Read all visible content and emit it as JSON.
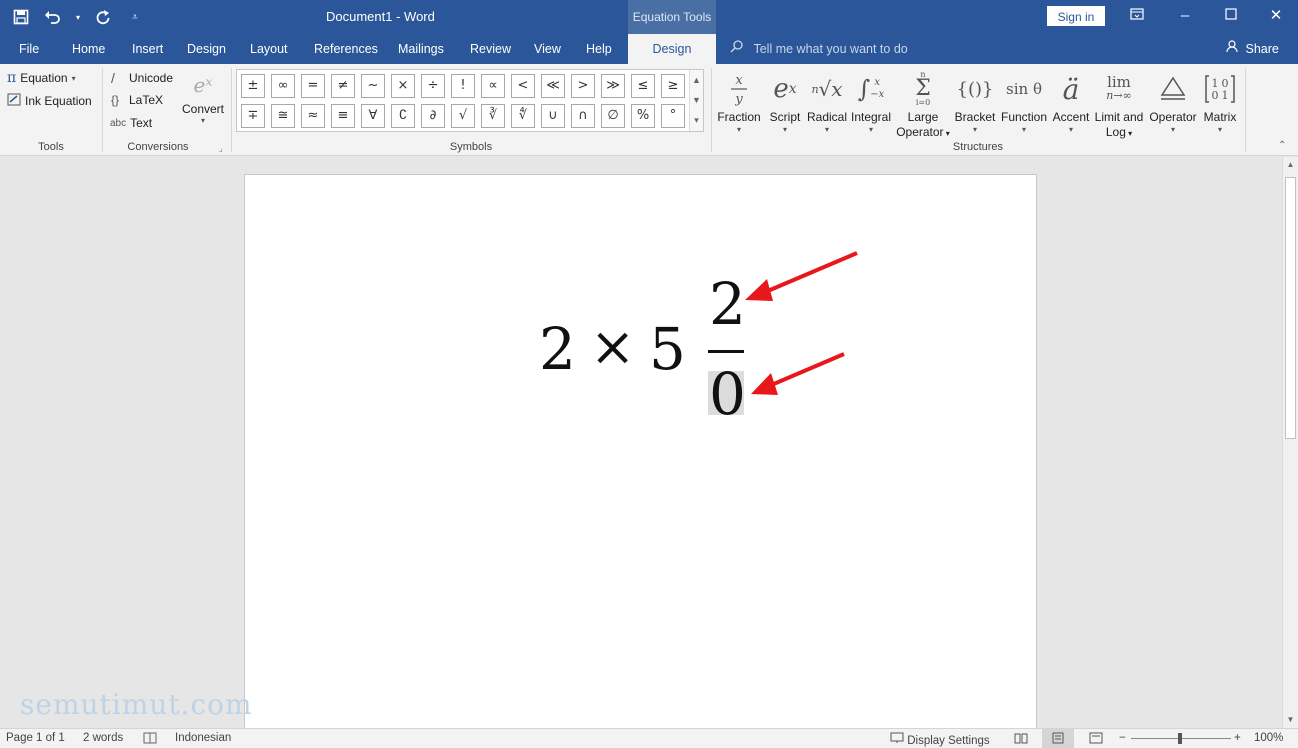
{
  "titlebar": {
    "doc_title": "Document1  -  Word",
    "context_tab": "Equation Tools",
    "signin": "Sign in"
  },
  "tabs": [
    "File",
    "Home",
    "Insert",
    "Design",
    "Layout",
    "References",
    "Mailings",
    "Review",
    "View",
    "Help"
  ],
  "active_tab": "Design",
  "tellme": "Tell me what you want to do",
  "share": "Share",
  "tools": {
    "equation": "Equation",
    "ink_equation": "Ink Equation",
    "label": "Tools"
  },
  "conversions": {
    "unicode": "Unicode",
    "latex": "LaTeX",
    "text": "Text",
    "text_prefix": "abc",
    "convert": "Convert",
    "label": "Conversions"
  },
  "symbols": {
    "row1": [
      "±",
      "∞",
      "=",
      "≠",
      "~",
      "×",
      "÷",
      "!",
      "∝",
      "<",
      "≪",
      ">",
      "≫",
      "≤",
      "≥"
    ],
    "row2": [
      "∓",
      "≅",
      "≈",
      "≡",
      "∀",
      "∁",
      "∂",
      "√",
      "∛",
      "∜",
      "∪",
      "∩",
      "∅",
      "%",
      "°"
    ],
    "label": "Symbols"
  },
  "structures": {
    "items": [
      {
        "label": "Fraction",
        "glyph": "x/y"
      },
      {
        "label": "Script",
        "glyph": "eˣ"
      },
      {
        "label": "Radical",
        "glyph": "ⁿ√x"
      },
      {
        "label": "Integral",
        "glyph": "∫"
      },
      {
        "label": "Large",
        "label2": "Operator",
        "glyph": "Σ"
      },
      {
        "label": "Bracket",
        "glyph": "{()}"
      },
      {
        "label": "Function",
        "glyph": "sin θ"
      },
      {
        "label": "Accent",
        "glyph": "ä"
      },
      {
        "label": "Limit and",
        "label2": "Log",
        "glyph": "lim"
      },
      {
        "label": "Operator",
        "glyph": "Δ"
      },
      {
        "label": "Matrix",
        "glyph": "[10;01]"
      }
    ],
    "label": "Structures"
  },
  "equation": {
    "left": "2",
    "times": "×",
    "right": "5",
    "numerator": "2",
    "denominator": "0"
  },
  "watermark": "semutimut.com",
  "status": {
    "page": "Page 1 of 1",
    "words": "2 words",
    "language": "Indonesian",
    "display_settings": "Display Settings",
    "zoom": "100%",
    "zoom_level": 1.0
  },
  "colors": {
    "accent": "#2b579a",
    "arrow": "#e8171b"
  }
}
